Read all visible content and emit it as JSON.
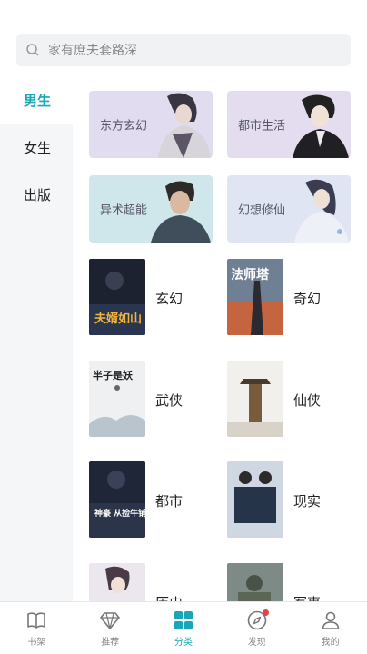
{
  "search": {
    "placeholder": "家有庶夫套路深"
  },
  "sidebar": {
    "items": [
      {
        "label": "男生"
      },
      {
        "label": "女生"
      },
      {
        "label": "出版"
      }
    ]
  },
  "banners": [
    {
      "label": "东方玄幻"
    },
    {
      "label": "都市生活"
    },
    {
      "label": "异术超能"
    },
    {
      "label": "幻想修仙"
    }
  ],
  "books": [
    {
      "title": "玄幻",
      "cover_text": "夫婿如山"
    },
    {
      "title": "奇幻",
      "cover_text": "法师塔"
    },
    {
      "title": "武侠",
      "cover_text": "半子是妖"
    },
    {
      "title": "仙侠",
      "cover_text": ""
    },
    {
      "title": "都市",
      "cover_text": "神豪 从捡牛铺程开始"
    },
    {
      "title": "现实",
      "cover_text": ""
    },
    {
      "title": "历史",
      "cover_text": ""
    },
    {
      "title": "军事",
      "cover_text": ""
    }
  ],
  "tabbar": {
    "items": [
      {
        "label": "书架",
        "icon": "book-icon"
      },
      {
        "label": "推荐",
        "icon": "diamond-icon"
      },
      {
        "label": "分类",
        "icon": "grid-icon"
      },
      {
        "label": "发现",
        "icon": "compass-icon"
      },
      {
        "label": "我的",
        "icon": "user-icon"
      }
    ]
  },
  "colors": {
    "accent": "#1aa6b7",
    "badge": "#e54242"
  }
}
